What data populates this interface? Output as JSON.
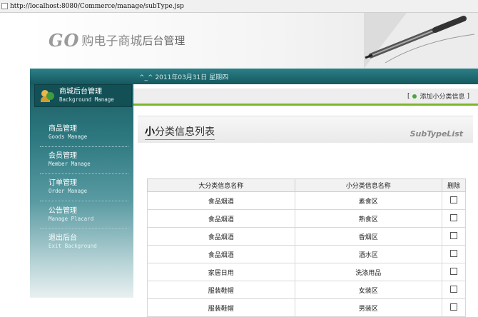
{
  "browser": {
    "url": "http://localhost:8080/Commerce/manage/subType.jsp"
  },
  "header": {
    "logo_go": "GO",
    "logo_cn": "购电子商城",
    "logo_admin": "后台管理",
    "date_text": "^_^ 2011年03月31日 星期四"
  },
  "sidebar": {
    "head": {
      "label": "商城后台管理",
      "sub": "Background Manage"
    },
    "items": [
      {
        "label": "商品管理",
        "sub": "Goods Manage"
      },
      {
        "label": "会员管理",
        "sub": "Member Manage"
      },
      {
        "label": "订单管理",
        "sub": "Order Manage"
      },
      {
        "label": "公告管理",
        "sub": "Manage Placard"
      },
      {
        "label": "退出后台",
        "sub": "Exit Background"
      }
    ]
  },
  "toolbar": {
    "open_bracket": "[",
    "add_link": "添加小分类信息",
    "close_bracket": "]"
  },
  "panel": {
    "title_prefix": "小",
    "title_rest": "分类信息列表",
    "title_en": "SubTypeList"
  },
  "table": {
    "headers": [
      "大分类信息名称",
      "小分类信息名称",
      "删除"
    ],
    "rows": [
      [
        "食品烟酒",
        "素食区"
      ],
      [
        "食品烟酒",
        "熟食区"
      ],
      [
        "食品烟酒",
        "香烟区"
      ],
      [
        "食品烟酒",
        "酒水区"
      ],
      [
        "家居日用",
        "洗涤用品"
      ],
      [
        "服装鞋帽",
        "女装区"
      ],
      [
        "服装鞋帽",
        "男装区"
      ]
    ]
  }
}
